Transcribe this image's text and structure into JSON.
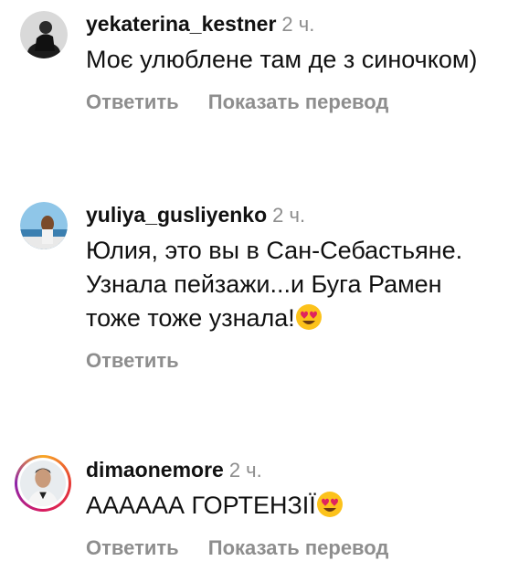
{
  "comments": [
    {
      "username": "yekaterina_kestner",
      "time": "2 ч.",
      "text": "Моє улюблене там де з синочком)",
      "reply": "Ответить",
      "translate": "Показать перевод",
      "avatar": "user-avatar"
    },
    {
      "username": "yuliya_gusliyenko",
      "time": "2 ч.",
      "text": "Юлия, это вы в Сан-Себастьяне. Узнала пейзажи...и Буга Рамен тоже тоже узнала!",
      "reply": "Ответить",
      "emoji": "heart-eyes-emoji",
      "avatar": "user-avatar"
    },
    {
      "username": "dimaonemore",
      "time": "2 ч.",
      "text": "АААААА ГОРТЕНЗІЇ",
      "reply": "Ответить",
      "translate": "Показать перевод",
      "emoji": "heart-eyes-emoji",
      "avatar": "user-avatar-with-story-ring"
    }
  ]
}
